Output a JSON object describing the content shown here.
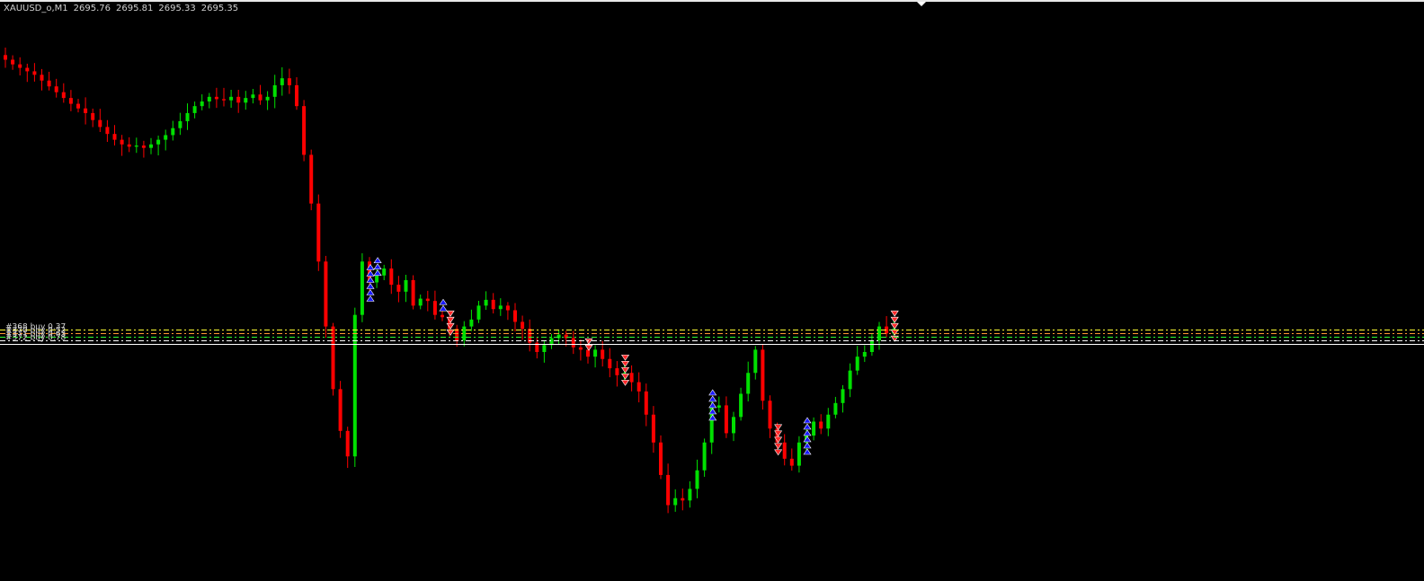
{
  "header": {
    "symbol": "XAUUSD_o,M1",
    "open": "2695.76",
    "high": "2695.81",
    "low": "2695.33",
    "close": "2695.35"
  },
  "colors": {
    "background": "#000000",
    "bull_candle": "#00e000",
    "bear_candle": "#ff0000",
    "buy_trade_marker": "#1a1aff",
    "sell_trade_marker": "#ff2a2a",
    "level_lines": [
      "#ffff33",
      "#ff9933",
      "#33ff33",
      "#ffffff"
    ],
    "current_price_line": "#ffffff"
  },
  "chart_data": {
    "type": "candlestick",
    "price_range": [
      2678.0,
      2702.0
    ],
    "grid": false,
    "closes": [
      2700.2,
      2700.0,
      2699.85,
      2699.7,
      2699.55,
      2699.3,
      2699.05,
      2698.8,
      2698.55,
      2698.3,
      2698.1,
      2697.9,
      2697.6,
      2697.3,
      2697.0,
      2696.75,
      2696.55,
      2696.45,
      2696.5,
      2696.4,
      2696.55,
      2696.75,
      2696.95,
      2697.25,
      2697.55,
      2697.9,
      2698.2,
      2698.4,
      2698.6,
      2698.5,
      2698.45,
      2698.6,
      2698.35,
      2698.55,
      2698.7,
      2698.45,
      2698.6,
      2699.1,
      2699.4,
      2699.1,
      2698.2,
      2696.1,
      2694.0,
      2691.5,
      2688.7,
      2686.0,
      2684.2,
      2683.1,
      2689.2,
      2691.5,
      2690.6,
      2690.9,
      2691.2,
      2690.5,
      2690.2,
      2690.7,
      2689.6,
      2689.9,
      2689.8,
      2689.2,
      2689.1,
      2688.6,
      2688.1,
      2688.7,
      2689.0,
      2689.6,
      2689.85,
      2689.45,
      2689.6,
      2689.4,
      2688.9,
      2688.6,
      2688.0,
      2687.6,
      2687.9,
      2688.2,
      2688.35,
      2688.2,
      2687.8,
      2687.7,
      2687.4,
      2687.7,
      2687.3,
      2686.9,
      2686.6,
      2686.7,
      2686.3,
      2685.9,
      2684.9,
      2683.7,
      2682.3,
      2681.0,
      2681.3,
      2681.2,
      2681.7,
      2682.5,
      2683.7,
      2685.2,
      2685.3,
      2684.1,
      2684.8,
      2685.8,
      2686.7,
      2687.7,
      2685.5,
      2684.3,
      2683.7,
      2683.0,
      2682.7,
      2683.7,
      2684.0,
      2684.6,
      2684.3,
      2684.9,
      2685.4,
      2686.0,
      2686.8,
      2687.4,
      2687.6,
      2688.1,
      2688.7,
      2688.4,
      2688.6
    ],
    "trade_levels": [
      {
        "label": "#368 buy 0.37",
        "color": "#ffff33"
      },
      {
        "label": "#370 buy 0.52",
        "color": "#ff9933"
      },
      {
        "label": "#371 buy 0.63",
        "color": "#33ff33"
      },
      {
        "label": "#372 buy 0.78",
        "color": "#ffffff"
      }
    ]
  }
}
